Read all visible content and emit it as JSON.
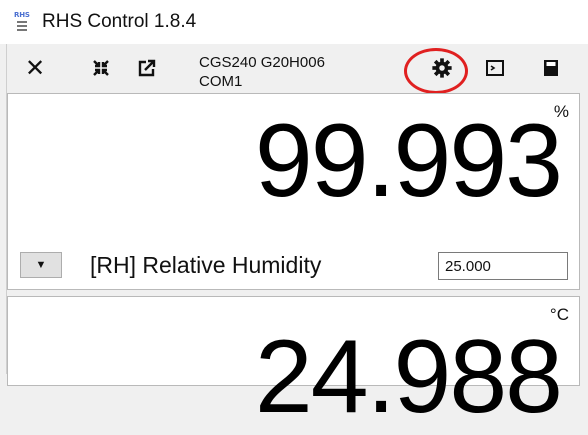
{
  "window": {
    "title": "RHS Control 1.8.4",
    "logo_text": "RHS"
  },
  "toolbar": {
    "close_glyph": "✕",
    "device_line1": "CGS240 G20H006",
    "device_line2": "COM1",
    "icons": [
      "close-icon",
      "collapse-icon",
      "popout-icon",
      "gear-icon",
      "terminal-icon",
      "calculator-icon"
    ],
    "highlight_color": "#e02020"
  },
  "panels": [
    {
      "unit": "%",
      "value": "99.993",
      "quantity": "[RH] Relative Humidity",
      "setpoint": "25.000",
      "dropdown_glyph": "▼"
    },
    {
      "unit": "°C",
      "value": "24.988"
    }
  ]
}
